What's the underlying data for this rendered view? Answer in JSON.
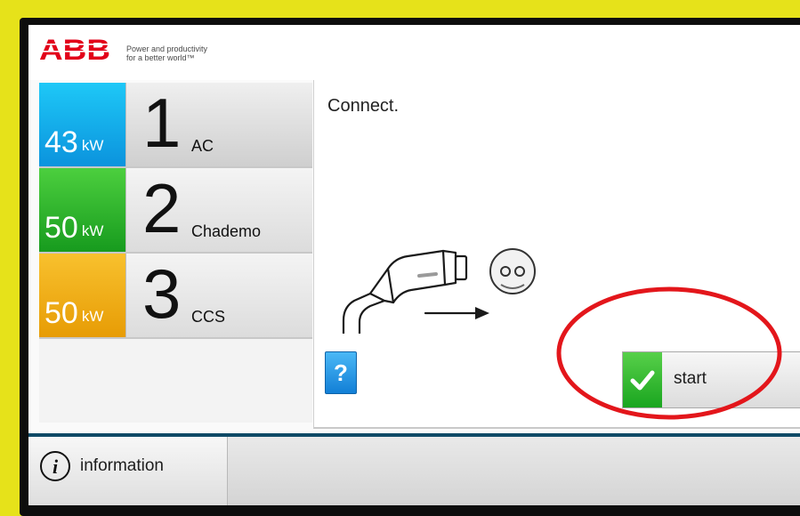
{
  "brand": {
    "logo_text": "ABB",
    "tagline_line1": "Power and productivity",
    "tagline_line2": "for a better world™",
    "color": "#e2001a"
  },
  "connectors": [
    {
      "power": "43",
      "unit": "kW",
      "number": "1",
      "type": "AC",
      "color": "#0b93dd"
    },
    {
      "power": "50",
      "unit": "kW",
      "number": "2",
      "type": "Chademo",
      "color": "#179b1e"
    },
    {
      "power": "50",
      "unit": "kW",
      "number": "3",
      "type": "CCS",
      "color": "#e79c05"
    }
  ],
  "main": {
    "instruction": "Connect.",
    "help_label": "?",
    "start_label": "start"
  },
  "footer": {
    "info_icon": "i",
    "info_label": "information"
  },
  "icons": {
    "plug": "charging-plug-icon",
    "socket": "socket-icon",
    "arrow": "arrow-right-icon",
    "check": "checkmark-icon",
    "info": "info-icon"
  },
  "annotation": {
    "highlight_color": "#e3161b"
  }
}
